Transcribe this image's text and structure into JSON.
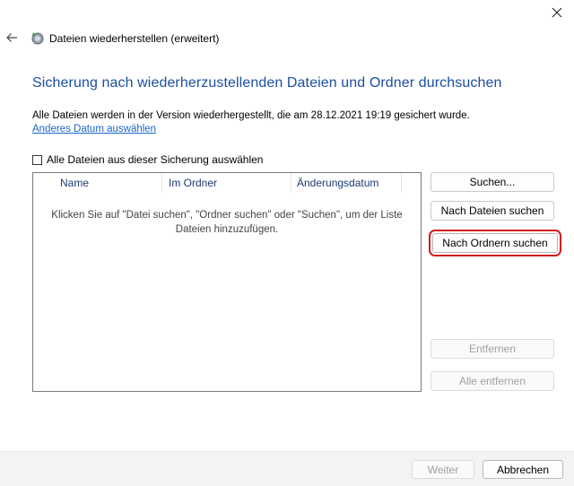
{
  "window": {
    "title": "Dateien wiederherstellen (erweitert)"
  },
  "heading": "Sicherung nach wiederherzustellenden Dateien und Ordner durchsuchen",
  "info_text": "Alle Dateien werden in der Version wiederhergestellt, die am 28.12.2021 19:19 gesichert wurde.",
  "change_date_link": "Anderes Datum auswählen",
  "select_all_label": "Alle Dateien aus dieser Sicherung auswählen",
  "list": {
    "columns": [
      "Name",
      "Im Ordner",
      "Änderungsdatum"
    ],
    "empty_message_line1": "Klicken Sie auf \"Datei suchen\", \"Ordner suchen\" oder \"Suchen\", um der Liste",
    "empty_message_line2": "Dateien hinzuzufügen."
  },
  "side_buttons": {
    "search": "Suchen...",
    "search_files": "Nach Dateien suchen",
    "search_folders": "Nach Ordnern suchen",
    "remove": "Entfernen",
    "remove_all": "Alle entfernen"
  },
  "footer": {
    "next": "Weiter",
    "cancel": "Abbrechen"
  },
  "colors": {
    "heading": "#1b4fa0",
    "link": "#1a66c8",
    "highlight": "#d21c1c"
  },
  "icons": {
    "close": "close-icon",
    "back": "back-arrow-icon",
    "app": "restore-app-icon"
  }
}
